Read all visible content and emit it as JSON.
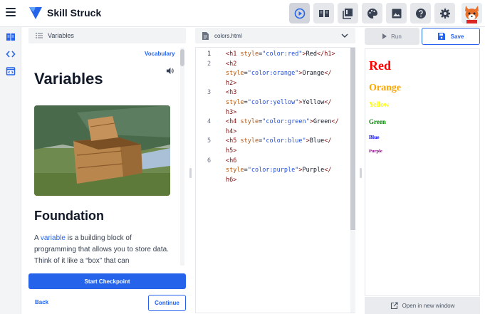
{
  "app": {
    "brand": "Skill Struck"
  },
  "toolbar": {
    "icons": [
      "play-circle-icon",
      "book-open-icon",
      "library-icon",
      "palette-icon",
      "image-icon",
      "help-icon",
      "gear-icon"
    ]
  },
  "lesson": {
    "header": "Variables",
    "vocabulary": "Vocabulary",
    "title": "Variables",
    "section_title": "Foundation",
    "paragraph_prefix": "A ",
    "paragraph_link": "variable",
    "paragraph_rest": " is a building block of programming that allows you to store data. Think of it like a “box” that can",
    "start_checkpoint": "Start Checkpoint",
    "back": "Back",
    "continue": "Continue"
  },
  "editor": {
    "filename": "colors.html",
    "line_numbers": [
      "1",
      "2",
      "3",
      "4",
      "5",
      "6"
    ],
    "lines": [
      {
        "num": "1",
        "parts": [
          [
            "tag",
            "<h1 "
          ],
          [
            "attr",
            "style"
          ],
          [
            "eq",
            "="
          ],
          [
            "str",
            "\"color:red\""
          ],
          [
            "tag",
            ">"
          ],
          [
            "eq",
            "Red"
          ],
          [
            "tag",
            "</h1>"
          ]
        ]
      },
      {
        "num": "2",
        "parts": [
          [
            "tag",
            "<h2"
          ]
        ]
      },
      {
        "num": "",
        "parts": [
          [
            "attr",
            "style"
          ],
          [
            "eq",
            "="
          ],
          [
            "str",
            "\"color:orange\""
          ],
          [
            "tag",
            ">"
          ],
          [
            "eq",
            "Orange"
          ],
          [
            "tag",
            "</"
          ]
        ]
      },
      {
        "num": "",
        "parts": [
          [
            "tag",
            "h2>"
          ]
        ]
      },
      {
        "num": "3",
        "parts": [
          [
            "tag",
            "<h3"
          ]
        ]
      },
      {
        "num": "",
        "parts": [
          [
            "attr",
            "style"
          ],
          [
            "eq",
            "="
          ],
          [
            "str",
            "\"color:yellow\""
          ],
          [
            "tag",
            ">"
          ],
          [
            "eq",
            "Yellow"
          ],
          [
            "tag",
            "</"
          ]
        ]
      },
      {
        "num": "",
        "parts": [
          [
            "tag",
            "h3>"
          ]
        ]
      },
      {
        "num": "4",
        "parts": [
          [
            "tag",
            "<h4 "
          ],
          [
            "attr",
            "style"
          ],
          [
            "eq",
            "="
          ],
          [
            "str",
            "\"color:green\""
          ],
          [
            "tag",
            ">"
          ],
          [
            "eq",
            "Green"
          ],
          [
            "tag",
            "</"
          ]
        ]
      },
      {
        "num": "",
        "parts": [
          [
            "tag",
            "h4>"
          ]
        ]
      },
      {
        "num": "5",
        "parts": [
          [
            "tag",
            "<h5 "
          ],
          [
            "attr",
            "style"
          ],
          [
            "eq",
            "="
          ],
          [
            "str",
            "\"color:blue\""
          ],
          [
            "tag",
            ">"
          ],
          [
            "eq",
            "Blue"
          ],
          [
            "tag",
            "</"
          ]
        ]
      },
      {
        "num": "",
        "parts": [
          [
            "tag",
            "h5>"
          ]
        ]
      },
      {
        "num": "6",
        "parts": [
          [
            "tag",
            "<h6"
          ]
        ]
      },
      {
        "num": "",
        "parts": [
          [
            "attr",
            "style"
          ],
          [
            "eq",
            "="
          ],
          [
            "str",
            "\"color:purple\""
          ],
          [
            "tag",
            ">"
          ],
          [
            "eq",
            "Purple"
          ],
          [
            "tag",
            "</"
          ]
        ]
      },
      {
        "num": "",
        "parts": [
          [
            "tag",
            "h6>"
          ]
        ]
      }
    ]
  },
  "preview": {
    "run": "Run",
    "save": "Save",
    "open_new_window": "Open in new window",
    "headings": [
      {
        "text": "Red",
        "color": "#ff0000"
      },
      {
        "text": "Orange",
        "color": "#ffa500"
      },
      {
        "text": "Yellow",
        "color": "#ffff00"
      },
      {
        "text": "Green",
        "color": "#008000"
      },
      {
        "text": "Blue",
        "color": "#0000ff"
      },
      {
        "text": "Purple",
        "color": "#800080"
      }
    ]
  },
  "colors": {
    "accent": "#2563eb"
  }
}
